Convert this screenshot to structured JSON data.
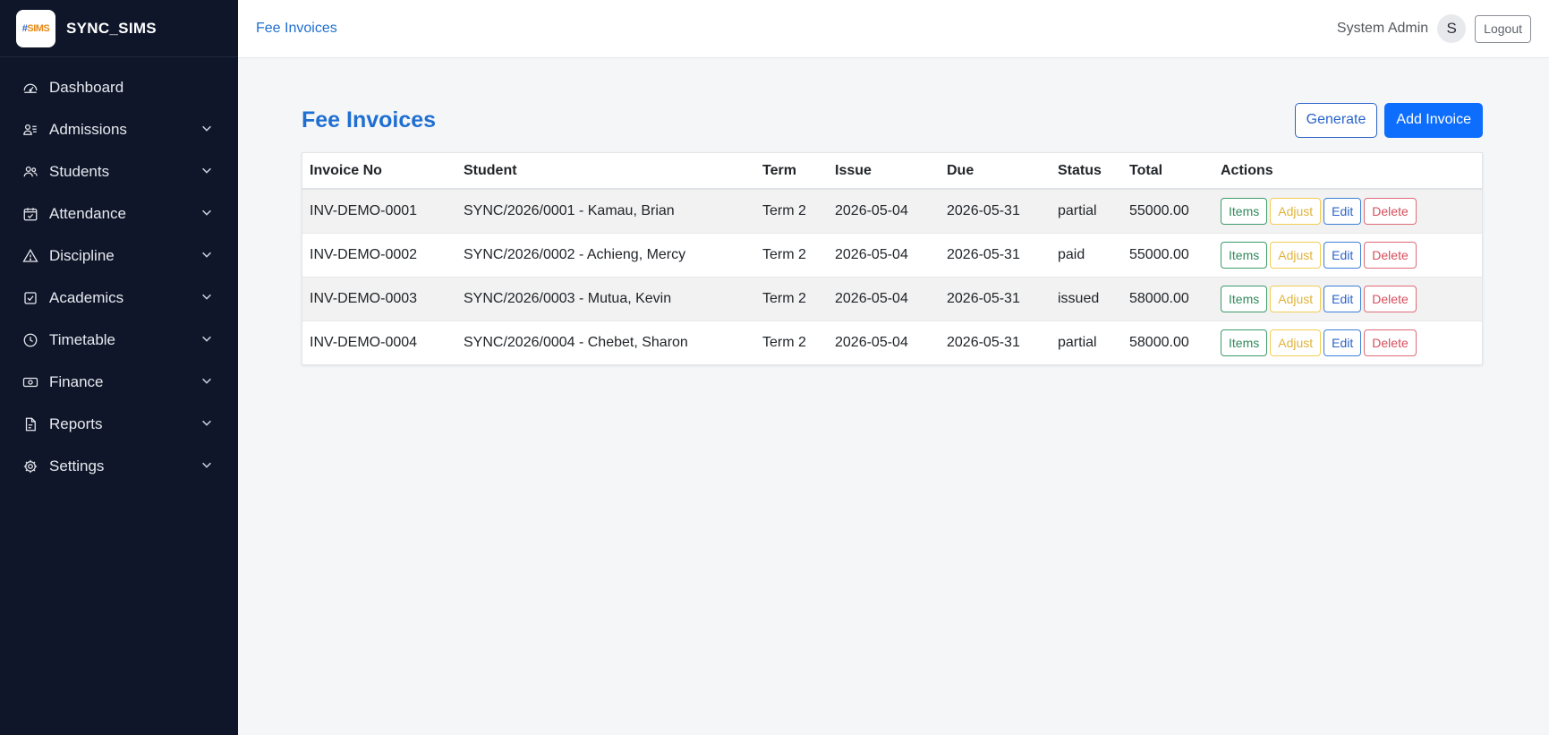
{
  "brand": {
    "logo_prefix": "#",
    "logo_main": "SIMS",
    "name": "SYNC_SIMS"
  },
  "sidebar": {
    "items": [
      {
        "label": "Dashboard",
        "icon": "dashboard-gauge-icon",
        "has_submenu": false
      },
      {
        "label": "Admissions",
        "icon": "user-list-icon",
        "has_submenu": true
      },
      {
        "label": "Students",
        "icon": "users-icon",
        "has_submenu": true
      },
      {
        "label": "Attendance",
        "icon": "calendar-check-icon",
        "has_submenu": true
      },
      {
        "label": "Discipline",
        "icon": "warning-triangle-icon",
        "has_submenu": true
      },
      {
        "label": "Academics",
        "icon": "checkbox-icon",
        "has_submenu": true
      },
      {
        "label": "Timetable",
        "icon": "clock-icon",
        "has_submenu": true
      },
      {
        "label": "Finance",
        "icon": "cash-icon",
        "has_submenu": true
      },
      {
        "label": "Reports",
        "icon": "document-icon",
        "has_submenu": true
      },
      {
        "label": "Settings",
        "icon": "gear-icon",
        "has_submenu": true
      }
    ]
  },
  "topbar": {
    "title": "Fee Invoices",
    "user_name": "System Admin",
    "avatar_initial": "S",
    "logout_label": "Logout"
  },
  "main": {
    "title": "Fee Invoices",
    "generate_label": "Generate",
    "add_label": "Add Invoice",
    "table": {
      "columns": [
        "Invoice No",
        "Student",
        "Term",
        "Issue",
        "Due",
        "Status",
        "Total",
        "Actions"
      ],
      "rows": [
        {
          "invoice_no": "INV-DEMO-0001",
          "student": "SYNC/2026/0001 - Kamau, Brian",
          "term": "Term 2",
          "issue": "2026-05-04",
          "due": "2026-05-31",
          "status": "partial",
          "total": "55000.00"
        },
        {
          "invoice_no": "INV-DEMO-0002",
          "student": "SYNC/2026/0002 - Achieng, Mercy",
          "term": "Term 2",
          "issue": "2026-05-04",
          "due": "2026-05-31",
          "status": "paid",
          "total": "55000.00"
        },
        {
          "invoice_no": "INV-DEMO-0003",
          "student": "SYNC/2026/0003 - Mutua, Kevin",
          "term": "Term 2",
          "issue": "2026-05-04",
          "due": "2026-05-31",
          "status": "issued",
          "total": "58000.00"
        },
        {
          "invoice_no": "INV-DEMO-0004",
          "student": "SYNC/2026/0004 - Chebet, Sharon",
          "term": "Term 2",
          "issue": "2026-05-04",
          "due": "2026-05-31",
          "status": "partial",
          "total": "58000.00"
        }
      ],
      "actions": {
        "items": "Items",
        "adjust": "Adjust",
        "edit": "Edit",
        "delete": "Delete"
      }
    }
  },
  "colors": {
    "sidebar_bg": "#0f1629",
    "accent": "#1f6fd1",
    "primary_button": "#0d6efd",
    "success": "#2f8a5b",
    "warning": "#e0b33a",
    "danger": "#d44f5d"
  }
}
